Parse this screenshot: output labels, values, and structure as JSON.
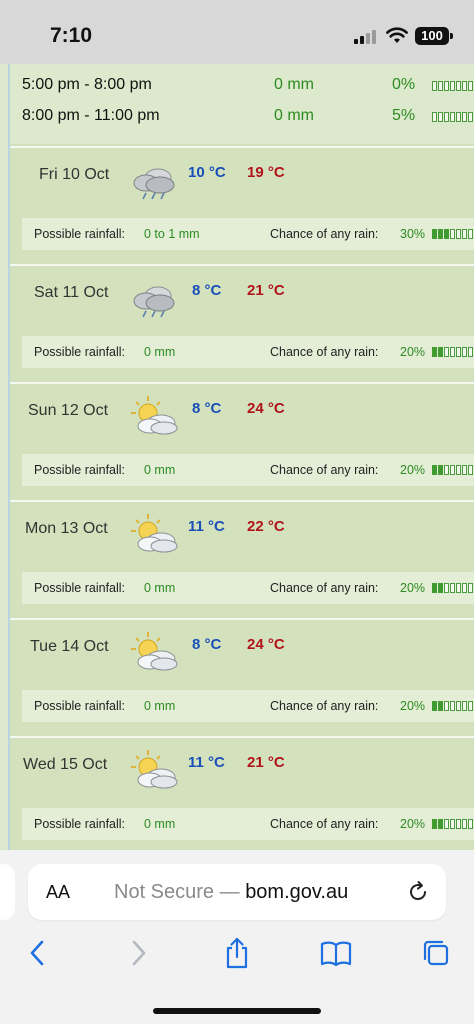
{
  "status": {
    "time": "7:10",
    "battery": "100"
  },
  "hourly": [
    {
      "period": "5:00 pm - 8:00 pm",
      "amount": "0 mm",
      "chance": "0%",
      "filled": 0
    },
    {
      "period": "8:00 pm - 11:00 pm",
      "amount": "0 mm",
      "chance": "5%",
      "filled": 0
    }
  ],
  "labels": {
    "rainfall": "Possible rainfall:",
    "chance": "Chance of any rain:"
  },
  "days": [
    {
      "date": "Fri 10 Oct",
      "icon": "showers-cloud-icon",
      "min": "10 °C",
      "max": "19 °C",
      "rainfall": "0 to 1 mm",
      "chance": "30%",
      "filled": 3
    },
    {
      "date": "Sat 11 Oct",
      "icon": "showers-cloud-icon",
      "min": "8 °C",
      "max": "21 °C",
      "rainfall": "0 mm",
      "chance": "20%",
      "filled": 2
    },
    {
      "date": "Sun 12 Oct",
      "icon": "partly-cloudy-icon",
      "min": "8 °C",
      "max": "24 °C",
      "rainfall": "0 mm",
      "chance": "20%",
      "filled": 2
    },
    {
      "date": "Mon 13 Oct",
      "icon": "partly-cloudy-icon",
      "min": "11 °C",
      "max": "22 °C",
      "rainfall": "0 mm",
      "chance": "20%",
      "filled": 2
    },
    {
      "date": "Tue 14 Oct",
      "icon": "partly-cloudy-icon",
      "min": "8 °C",
      "max": "24 °C",
      "rainfall": "0 mm",
      "chance": "20%",
      "filled": 2
    },
    {
      "date": "Wed 15 Oct",
      "icon": "partly-cloudy-icon",
      "min": "11 °C",
      "max": "21 °C",
      "rainfall": "0 mm",
      "chance": "20%",
      "filled": 2
    }
  ],
  "browser": {
    "aa_label": "AA",
    "security": "Not Secure",
    "separator": " — ",
    "domain": "bom.gov.au"
  },
  "colors": {
    "min_temp": "#1a4fb8",
    "max_temp": "#b0141a",
    "rain_green": "#2c8b22",
    "panel": "#d3e2bd"
  }
}
